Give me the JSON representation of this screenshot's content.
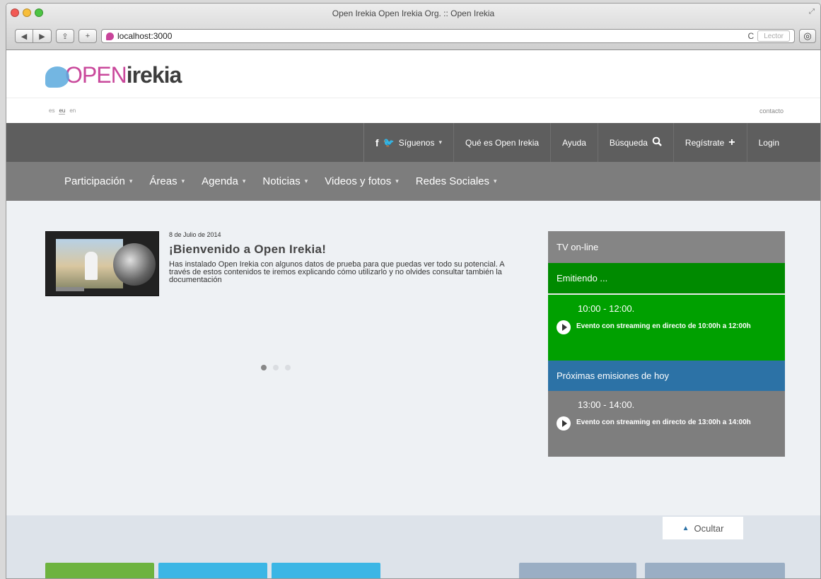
{
  "browser": {
    "window_title": "Open Irekia Open Irekia Org. :: Open Irekia",
    "url": "localhost:3000",
    "reader_label": "Lector",
    "back_icon": "back-arrow-icon",
    "forward_icon": "forward-arrow-icon"
  },
  "site": {
    "logo_open": "OPEN",
    "logo_irekia": "irekia",
    "languages": [
      "es",
      "eu",
      "en"
    ],
    "active_language_index": 0,
    "contacto": "contacto"
  },
  "topnav": {
    "siguenos": "Síguenos",
    "que_es": "Qué es Open Irekia",
    "ayuda": "Ayuda",
    "busqueda": "Búsqueda",
    "registrate": "Regístrate",
    "login": "Login"
  },
  "mainnav": [
    "Participación",
    "Áreas",
    "Agenda",
    "Noticias",
    "Videos y fotos",
    "Redes Sociales"
  ],
  "slide": {
    "date": "8 de Julio de 2014",
    "title": "¡Bienvenido a Open Irekia!",
    "body": "Has instalado Open Irekia con algunos datos de prueba para que puedas ver todo su potencial. A través de estos contenidos te iremos explicando cómo utilizarlo y no olvides consultar también la documentación",
    "dots_total": 3,
    "dots_active": 1
  },
  "tv": {
    "header": "TV on-line",
    "on_air": "Emitiendo ...",
    "current_time": "10:00 - 12:00.",
    "current_event": "Evento con streaming en directo de 10:00h a 12:00h",
    "next_header": "Próximas emisiones de hoy",
    "next_time": "13:00 - 14:00.",
    "next_event": "Evento con streaming en directo de 13:00h a 14:00h"
  },
  "lower": {
    "ocultar": "Ocultar"
  },
  "colors": {
    "topnav": "#5e5e5e",
    "mainnav": "#7d7d7d",
    "on_air": "#008a00",
    "event_green": "#00a000",
    "next_blue": "#2c72a6",
    "brand_pink": "#c9489b",
    "brand_blue": "#5aa9dd",
    "tile_green": "#6db33f",
    "tile_cyan": "#3bb6e5",
    "tile_slate": "#9aaec4"
  }
}
